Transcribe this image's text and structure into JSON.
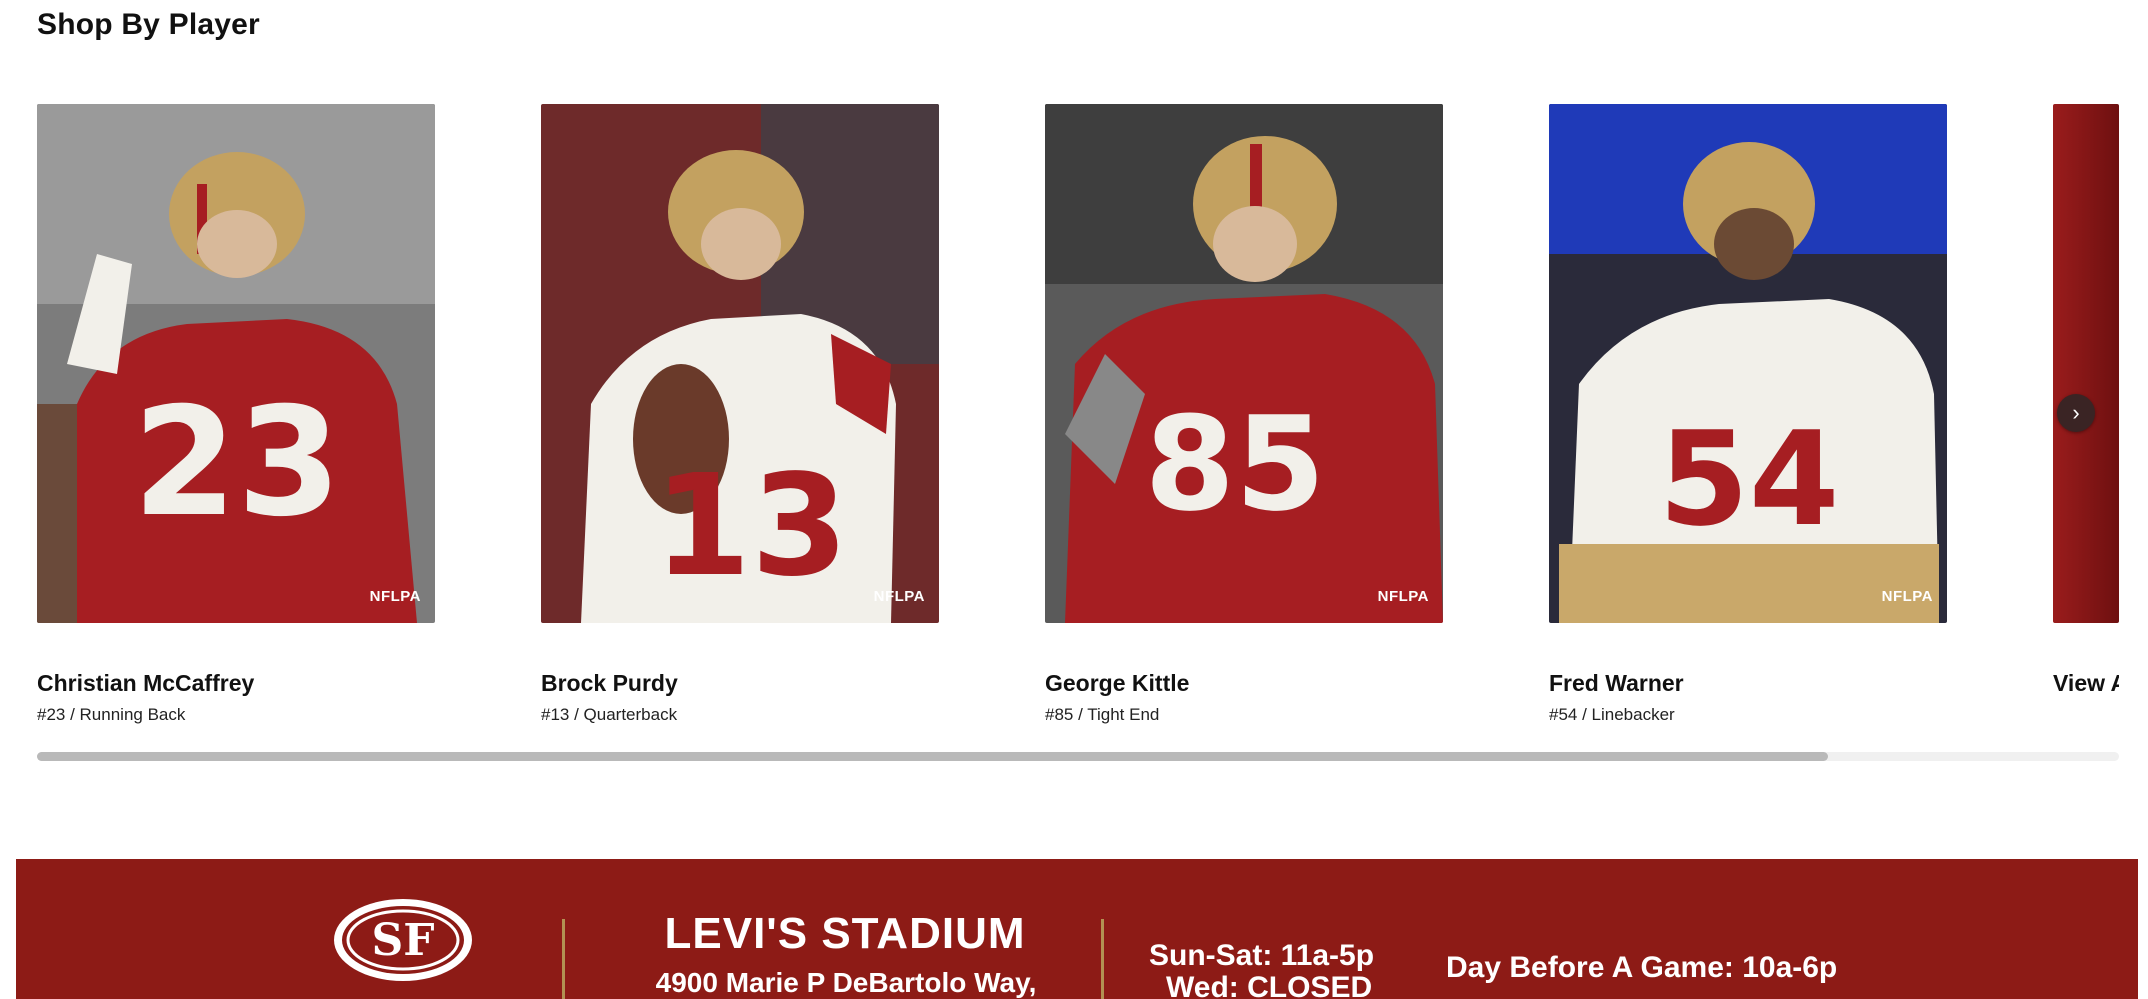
{
  "section": {
    "title": "Shop By Player"
  },
  "players": [
    {
      "name": "Christian McCaffrey",
      "detail": "#23 / Running Back",
      "number": "23",
      "badge": "NFLPA"
    },
    {
      "name": "Brock Purdy",
      "detail": "#13 / Quarterback",
      "number": "13",
      "badge": "NFLPA"
    },
    {
      "name": "George Kittle",
      "detail": "#85 / Tight End",
      "number": "85",
      "badge": "NFLPA"
    },
    {
      "name": "Fred Warner",
      "detail": "#54 / Linebacker",
      "number": "54",
      "badge": "NFLPA"
    }
  ],
  "view_all": {
    "label": "View A"
  },
  "carousel": {
    "next_icon": "chevron-right-icon",
    "next_glyph": "›",
    "scroll_progress": 0.86
  },
  "footer": {
    "stadium_title": "LEVI'S STADIUM",
    "address": "4900 Marie P DeBartolo Way,",
    "hours_line1": "Sun-Sat: 11a-5p",
    "hours_line2": "Wed: CLOSED",
    "game_day_hours": "Day Before A Game: 10a-6p",
    "logo_text": "SF"
  },
  "colors": {
    "team_red": "#8d1b16",
    "gold": "#b39152",
    "jersey_red": "#a61e22",
    "jersey_white": "#f2f0ea"
  }
}
